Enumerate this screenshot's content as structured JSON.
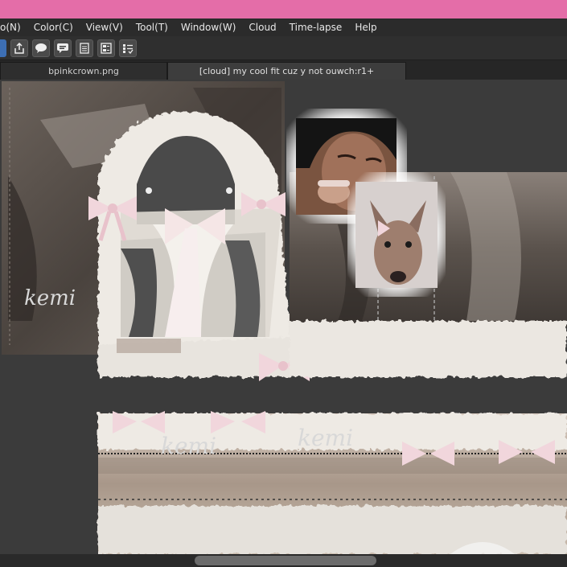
{
  "menubar": {
    "items": [
      "o(N)",
      "Color(C)",
      "View(V)",
      "Tool(T)",
      "Window(W)",
      "Cloud",
      "Time-lapse",
      "Help"
    ]
  },
  "toolbar": {
    "buttons": [
      "layer-icon",
      "share-icon",
      "comment-icon",
      "speech-icon",
      "page-icon",
      "panel-icon",
      "checklist-icon"
    ]
  },
  "tabs": [
    {
      "label": "bpinkcrown.png"
    },
    {
      "label": "[cloud] my cool fit cuz y not ouwch:r1+"
    }
  ],
  "canvas": {
    "signature": "kemi",
    "colors": {
      "fur": "#eeeae4",
      "bow": "#f1d6dc",
      "leather": "#5a524c",
      "wood": "#b8aaa0"
    }
  },
  "colors": {
    "titlebar": "#e46da8",
    "menubar": "#2b2b2b",
    "canvas_bg": "#3b3b3b"
  }
}
